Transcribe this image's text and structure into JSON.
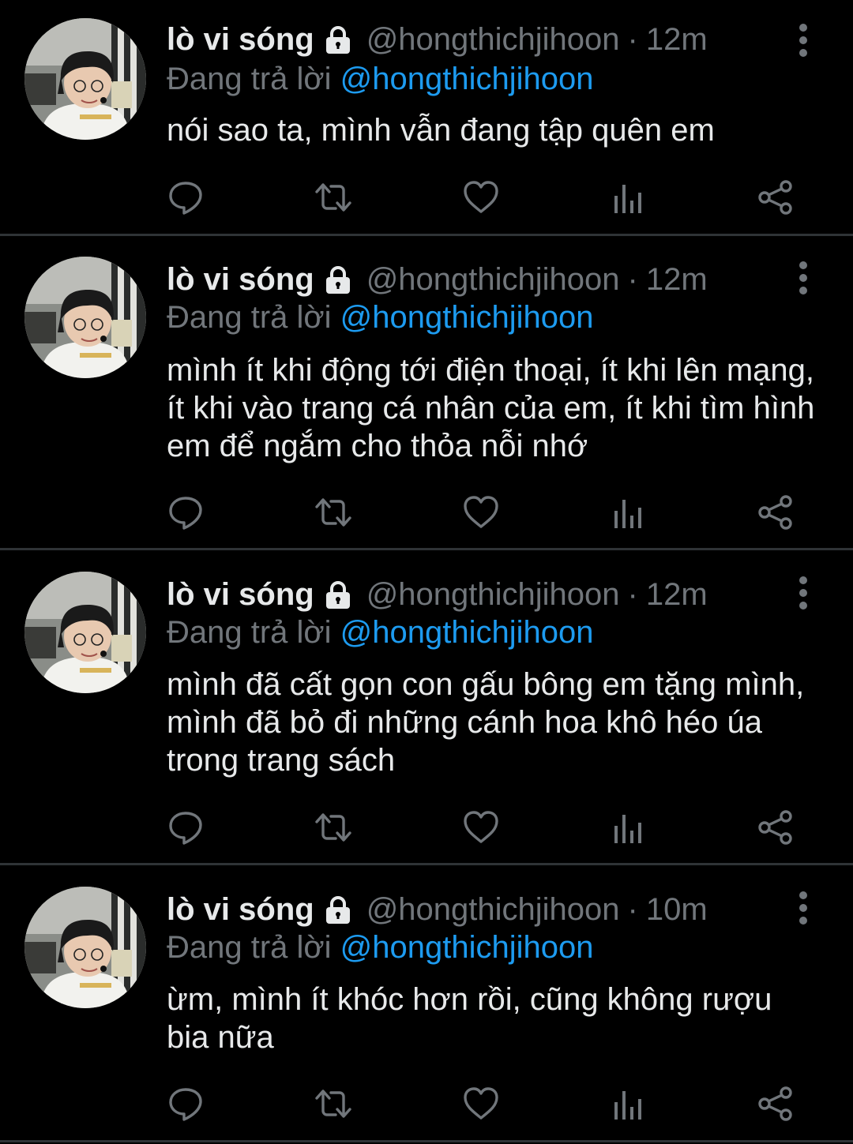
{
  "colors": {
    "background": "#000000",
    "primary_text": "#e7e9ea",
    "secondary_text": "#71767b",
    "accent": "#1d9bf0",
    "divider": "#2f3336"
  },
  "tweets": [
    {
      "display_name": "lò vi sóng",
      "protected_icon": "lock-icon",
      "handle": "@hongthichjihoon",
      "separator": "·",
      "time": "12m",
      "reply_prefix": "Đang trả lời",
      "reply_to": "@hongthichjihoon",
      "text": "nói sao ta, mình vẫn đang tập quên em"
    },
    {
      "display_name": "lò vi sóng",
      "protected_icon": "lock-icon",
      "handle": "@hongthichjihoon",
      "separator": "·",
      "time": "12m",
      "reply_prefix": "Đang trả lời",
      "reply_to": "@hongthichjihoon",
      "text": "mình ít khi động tới điện thoại, ít khi lên mạng, ít khi vào trang cá nhân của em, ít khi tìm hình em để ngắm cho thỏa nỗi nhớ"
    },
    {
      "display_name": "lò vi sóng",
      "protected_icon": "lock-icon",
      "handle": "@hongthichjihoon",
      "separator": "·",
      "time": "12m",
      "reply_prefix": "Đang trả lời",
      "reply_to": "@hongthichjihoon",
      "text": "mình đã cất gọn con gấu bông em tặng mình, mình đã bỏ đi những cánh hoa khô héo úa trong trang sách"
    },
    {
      "display_name": "lò vi sóng",
      "protected_icon": "lock-icon",
      "handle": "@hongthichjihoon",
      "separator": "·",
      "time": "10m",
      "reply_prefix": "Đang trả lời",
      "reply_to": "@hongthichjihoon",
      "text": "ừm, mình ít khóc hơn rồi, cũng không rượu bia nữa"
    }
  ],
  "action_icons": [
    "reply-icon",
    "retweet-icon",
    "like-icon",
    "views-icon",
    "share-icon"
  ],
  "menu_icon": "more-vertical-icon"
}
